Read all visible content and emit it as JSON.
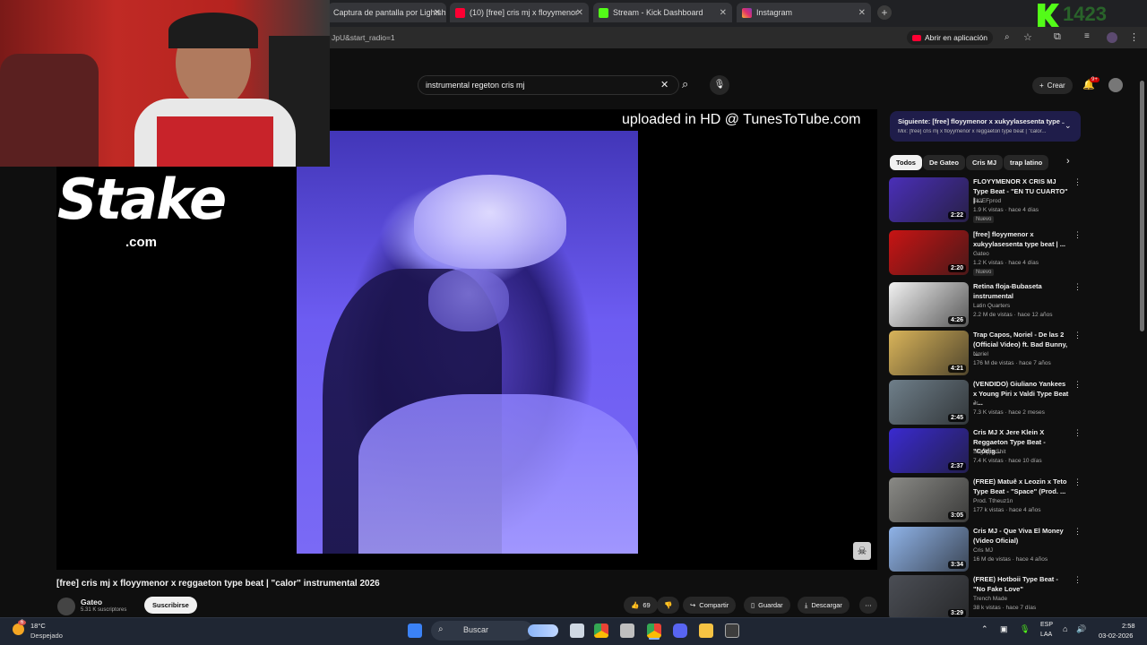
{
  "browser": {
    "tabs": [
      {
        "title": "Captura de pantalla por Lightshot"
      },
      {
        "title": "(10) [free] cris mj x floyymenor"
      },
      {
        "title": "Stream - Kick Dashboard"
      },
      {
        "title": "Instagram"
      }
    ],
    "address_fragment": "JpU&start_radio=1",
    "open_in_app": "Abrir en aplicación"
  },
  "kick_overlay": {
    "text": "1423"
  },
  "youtube": {
    "search_value": "instrumental regeton cris mj",
    "create_label": "Crear",
    "notif_count": "9+",
    "watermark": "uploaded in HD @ TunesToTube.com",
    "video_title": "[free] cris mj x floyymenor x reggaeton type beat | \"calor\" instrumental 2026",
    "channel_name": "Gateo",
    "subscribers": "5.31 K suscriptores",
    "subscribe_label": "Suscribirse",
    "like_count": "69",
    "share_label": "Compartir",
    "save_label": "Guardar",
    "download_label": "Descargar",
    "next_up": {
      "title": "Siguiente: [free] floyymenor x xukyylasesenta type ...",
      "sub": "Mix: [free] cris mj x floyymenor x reggaeton type beat | \"calor..."
    },
    "chips": [
      "Todos",
      "De Gateo",
      "Cris MJ",
      "trap latino"
    ],
    "recommendations": [
      {
        "title": "FLOYYMENOR X CRIS MJ Type Beat - \"EN TU CUARTO\" | ...",
        "channel": "$KIEFprod",
        "meta": "1.9 K vistas · hace 4 días",
        "badge": "Nuevo",
        "duration": "2:22",
        "thumb_color": "#4a2fb8"
      },
      {
        "title": "[free] floyymenor x xukyylasesenta type beat | ...",
        "channel": "Gateo",
        "meta": "1.2 K vistas · hace 4 días",
        "badge": "Nuevo",
        "duration": "2:20",
        "thumb_color": "#c81414"
      },
      {
        "title": "Retina floja-Bubaseta instrumental",
        "channel": "Latin Quarters",
        "meta": "2.2 M de vistas · hace 12 años",
        "badge": "",
        "duration": "4:26",
        "thumb_color": "#f2f2f2"
      },
      {
        "title": "Trap Capos, Noriel - De las 2 (Official Video) ft. Bad Bunny, ...",
        "channel": "Noriel",
        "meta": "176 M de vistas · hace 7 años",
        "badge": "",
        "duration": "4:21",
        "thumb_color": "#d9b45a"
      },
      {
        "title": "(VENDIDO) Giuliano Yankees x Young Piri x Valdi Type Beat - ...",
        "channel": "Jr.",
        "meta": "7.3 K vistas · hace 2 meses",
        "badge": "",
        "duration": "2:45",
        "thumb_color": "#6f7f8a"
      },
      {
        "title": "Cris MJ X Jere Klein X Reggaeton Type Beat - \"Códig...",
        "channel": "StigTypeShit",
        "meta": "7.4 K vistas · hace 10 días",
        "badge": "",
        "duration": "2:37",
        "thumb_color": "#3a2ad0"
      },
      {
        "title": "(FREE) Matuê x Leozin x Teto Type Beat - \"Space\" (Prod. ...",
        "channel": "Prod. Ttheuz1n",
        "meta": "177 k vistas · hace 4 años",
        "badge": "",
        "duration": "3:05",
        "thumb_color": "#8a8a86"
      },
      {
        "title": "Cris MJ - Que Viva El Money (Video Oficial)",
        "channel": "Cris MJ",
        "meta": "16 M de vistas · hace 4 años",
        "badge": "",
        "duration": "3:34",
        "thumb_color": "#8fb3e8"
      },
      {
        "title": "(FREE) Hotboii Type Beat - \"No Fake Love\"",
        "channel": "Trench Made",
        "meta": "38 k vistas · hace 7 días",
        "badge": "",
        "duration": "3:29",
        "thumb_color": "#4b4e55"
      }
    ]
  },
  "stake_logo": {
    "word": "Stake",
    "suffix": ".com"
  },
  "taskbar": {
    "weather_temp": "18°C",
    "weather_desc": "Despejado",
    "search_label": "Buscar",
    "lang_top": "ESP",
    "lang_bottom": "LAA",
    "time": "2:58",
    "date": "03-02-2026"
  },
  "colors": {
    "accent_red": "#ff0033",
    "kick_green": "#53fc18",
    "youtube_bg": "#0f0f0f"
  }
}
